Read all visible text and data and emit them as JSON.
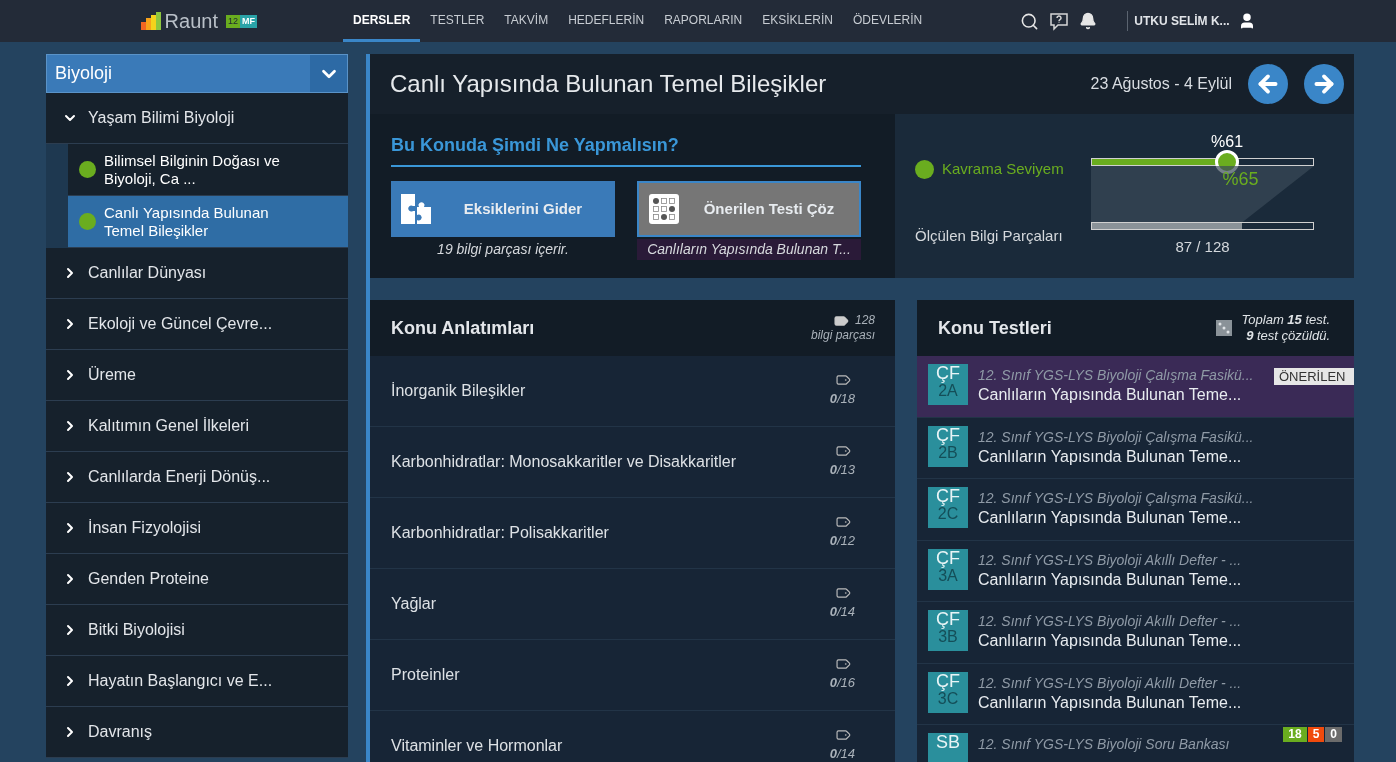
{
  "topbar": {
    "logo": {
      "name": "Raunt",
      "grade": "12",
      "track": "MF"
    },
    "tabs": [
      {
        "label": "DERSLER",
        "selected": true
      },
      {
        "label": "TESTLER",
        "selected": false
      },
      {
        "label": "TAKVİM",
        "selected": false
      },
      {
        "label": "HEDEFLERİN",
        "selected": false
      },
      {
        "label": "RAPORLARIN",
        "selected": false
      },
      {
        "label": "EKSİKLERİN",
        "selected": false
      },
      {
        "label": "ÖDEVLERİN",
        "selected": false
      }
    ],
    "user": "UTKU SELİM K..."
  },
  "sidebar": {
    "title": "Biyoloji",
    "items": [
      {
        "label": "Yaşam Bilimi Biyoloji",
        "expanded": true,
        "children": [
          {
            "label": "Bilimsel Bilginin Doğası ve Biyoloji, Ca ...",
            "selected": false
          },
          {
            "label": "Canlı Yapısında Bulunan Temel Bileşikler",
            "selected": true
          }
        ]
      },
      {
        "label": "Canlılar Dünyası",
        "expanded": false
      },
      {
        "label": "Ekoloji ve Güncel Çevre...",
        "expanded": false
      },
      {
        "label": "Üreme",
        "expanded": false
      },
      {
        "label": "Kalıtımın Genel İlkeleri",
        "expanded": false
      },
      {
        "label": "Canlılarda Enerji Dönüş...",
        "expanded": false
      },
      {
        "label": "İnsan Fizyolojisi",
        "expanded": false
      },
      {
        "label": "Genden Proteine",
        "expanded": false
      },
      {
        "label": "Bitki Biyolojisi",
        "expanded": false
      },
      {
        "label": "Hayatın Başlangıcı ve E...",
        "expanded": false
      },
      {
        "label": "Davranış",
        "expanded": false
      }
    ]
  },
  "topic": {
    "title": "Canlı Yapısında Bulunan Temel Bileşikler",
    "dates": "23 Ağustos - 4 Eylül"
  },
  "actions": {
    "heading": "Bu Konuda Şimdi Ne Yapmalısın?",
    "buttons": [
      {
        "label": "Eksiklerini Gider",
        "kind": "primary",
        "note": "19 bilgi parçası içerir."
      },
      {
        "label": "Önerilen Testi Çöz",
        "kind": "secondary",
        "note": "Canlıların Yapısında Bulunan T..."
      }
    ]
  },
  "progress": {
    "mastery": {
      "label": "Kavrama Seviyem",
      "value": "%61",
      "level": 0.61,
      "target": "%65"
    },
    "measured": {
      "label": "Ölçülen Bilgi Parçaları",
      "level": 0.68,
      "reading": "87 / 128"
    }
  },
  "lessons": {
    "title": "Konu Anlatımları",
    "count": "128",
    "count_label": "bilgi parçası",
    "rows": [
      {
        "title": "İnorganik Bileşikler",
        "score": "**0**/18"
      },
      {
        "title": "Karbonhidratlar: Monosakkaritler ve Disakkaritler",
        "score": "**0**/13"
      },
      {
        "title": "Karbonhidratlar: Polisakkaritler",
        "score": "**0**/12"
      },
      {
        "title": "Yağlar",
        "score": "**0**/14"
      },
      {
        "title": "Proteinler",
        "score": "**0**/16"
      },
      {
        "title": "Vitaminler ve Hormonlar",
        "score": "**0**/14"
      }
    ]
  },
  "tests": {
    "title": "Konu Testleri",
    "summary": [
      "Toplam **15** test.",
      "**9** test çözüldü."
    ],
    "rows": [
      {
        "code": "ÇF",
        "number": "2A",
        "book": "12. Sınıf YGS-LYS Biyoloji Çalışma Fasikü...",
        "title": "Canlıların Yapısında Bulunan Teme...",
        "selected": true,
        "badge": "ÖNERİLEN"
      },
      {
        "code": "ÇF",
        "number": "2B",
        "book": "12. Sınıf YGS-LYS Biyoloji Çalışma Fasikü...",
        "title": "Canlıların Yapısında Bulunan Teme...",
        "selected": false
      },
      {
        "code": "ÇF",
        "number": "2C",
        "book": "12. Sınıf YGS-LYS Biyoloji Çalışma Fasikü...",
        "title": "Canlıların Yapısında Bulunan Teme...",
        "selected": false
      },
      {
        "code": "ÇF",
        "number": "3A",
        "book": "12. Sınıf YGS-LYS Biyoloji Akıllı Defter - ...",
        "title": "Canlıların Yapısında Bulunan Teme...",
        "selected": false
      },
      {
        "code": "ÇF",
        "number": "3B",
        "book": "12. Sınıf YGS-LYS Biyoloji Akıllı Defter - ...",
        "title": "Canlıların Yapısında Bulunan Teme...",
        "selected": false
      },
      {
        "code": "ÇF",
        "number": "3C",
        "book": "12. Sınıf YGS-LYS Biyoloji Akıllı Defter - ...",
        "title": "Canlıların Yapısında Bulunan Teme...",
        "selected": false
      },
      {
        "code": "SB",
        "book": "12. Sınıf YGS-LYS Biyoloji Soru Bankası",
        "selected": false,
        "results": [
          {
            "value": "18",
            "color": "#6aad1f"
          },
          {
            "value": "5",
            "color": "#f04a0c"
          },
          {
            "value": "0",
            "color": "#6b6b6b"
          }
        ]
      }
    ]
  }
}
